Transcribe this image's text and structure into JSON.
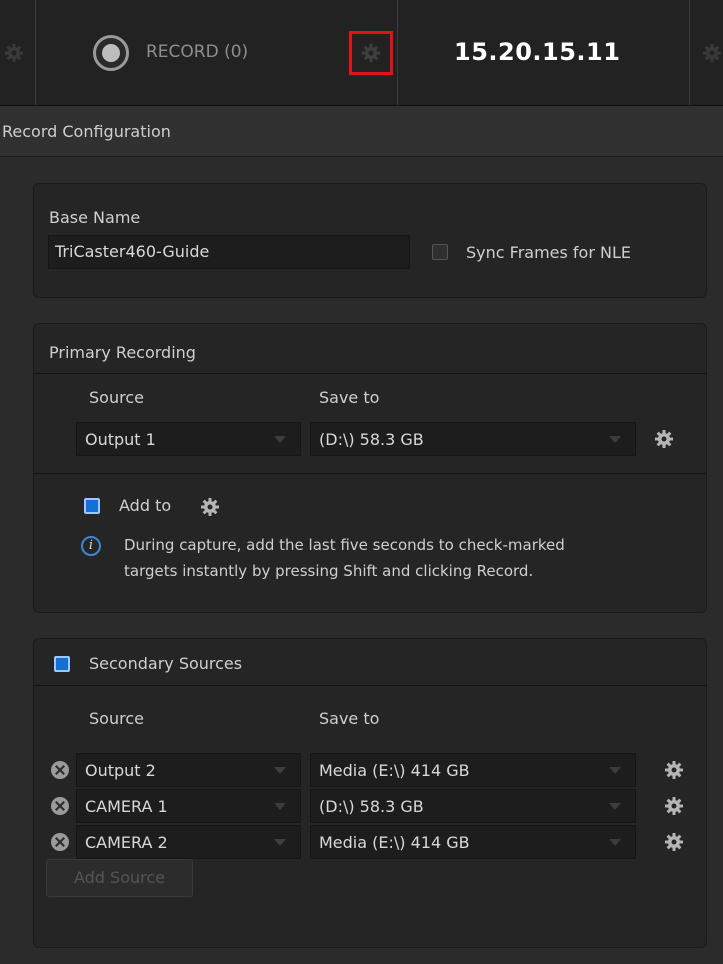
{
  "topbar": {
    "record_label": "RECORD (0)",
    "timecode": "15.20.15.11",
    "record_config_highlight_color": "#e0131b"
  },
  "config": {
    "title": "Record Configuration"
  },
  "base": {
    "label": "Base Name",
    "value": "TriCaster460-Guide",
    "sync_label": "Sync Frames for NLE",
    "sync_checked": false
  },
  "primary": {
    "title": "Primary Recording",
    "source_header": "Source",
    "save_header": "Save to",
    "source": "Output 1",
    "save_to": "(D:\\) 58.3 GB",
    "add_to_label": "Add to",
    "add_to_checked": true,
    "info_text_line1": "During capture, add the last five seconds to check-marked",
    "info_text_line2": "targets instantly by pressing Shift and clicking Record."
  },
  "secondary": {
    "title": "Secondary Sources",
    "enabled": true,
    "source_header": "Source",
    "save_header": "Save to",
    "rows": [
      {
        "source": "Output 2",
        "save_to": "Media (E:\\) 414 GB"
      },
      {
        "source": "CAMERA 1",
        "save_to": " (D:\\) 58.3 GB"
      },
      {
        "source": "CAMERA 2",
        "save_to": "Media (E:\\) 414 GB"
      }
    ],
    "add_source_label": "Add Source"
  },
  "icons": {
    "gear": "gear-icon",
    "remove": "remove-circle-icon",
    "info": "info-icon",
    "caret": "chevron-down-icon"
  },
  "colors": {
    "checkbox_blue": "#1570d6",
    "background": "#2b2b2b"
  }
}
